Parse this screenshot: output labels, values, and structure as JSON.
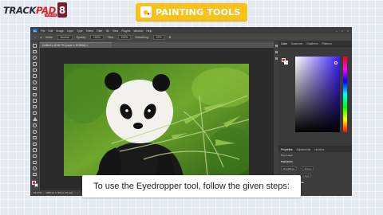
{
  "logo": {
    "brand_dark": "TRACK",
    "brand_red": "PAD",
    "brand_sub": "VER 5.0",
    "grade": "8"
  },
  "title": {
    "text": "PAINTING TOOLS"
  },
  "photoshop": {
    "menu": [
      "File",
      "Edit",
      "Image",
      "Layer",
      "Type",
      "Select",
      "Filter",
      "3D",
      "View",
      "Plugins",
      "Window",
      "Help"
    ],
    "options": {
      "mode_label": "Mode:",
      "mode_value": "Normal",
      "opacity_label": "Opacity:",
      "opacity_value": "100%",
      "flow_label": "Flow:",
      "flow_value": "100%",
      "smoothing_label": "Smoothing:",
      "smoothing_value": "10%"
    },
    "doc_tab": "Untitled-1 @ 66.7% (Layer 1, RGB/8#) ×",
    "status": {
      "zoom": "66.67%",
      "size": "1280 px x 720 px (72 ppi)"
    },
    "panel_tabs": [
      "Color",
      "Swatches",
      "Gradients",
      "Patterns"
    ],
    "prop_tabs": [
      "Properties",
      "Adjustments",
      "Libraries"
    ],
    "prop_layer": "Pixel Layer",
    "prop_transform": "Transform",
    "prop_w": "W 1280 px",
    "prop_h": "H 720 px",
    "prop_x": "X 0 px",
    "prop_y": "Y 0 px",
    "prop_align": "Align and Distribute",
    "prop_layers": "Layers",
    "prop_paths": "Paths"
  },
  "caption": {
    "text": "To use the Eyedropper tool, follow the given steps:"
  },
  "colors": {
    "accent_yellow": "#f6c21b",
    "brand_red": "#d9262b",
    "foreground": "#d1262c"
  }
}
